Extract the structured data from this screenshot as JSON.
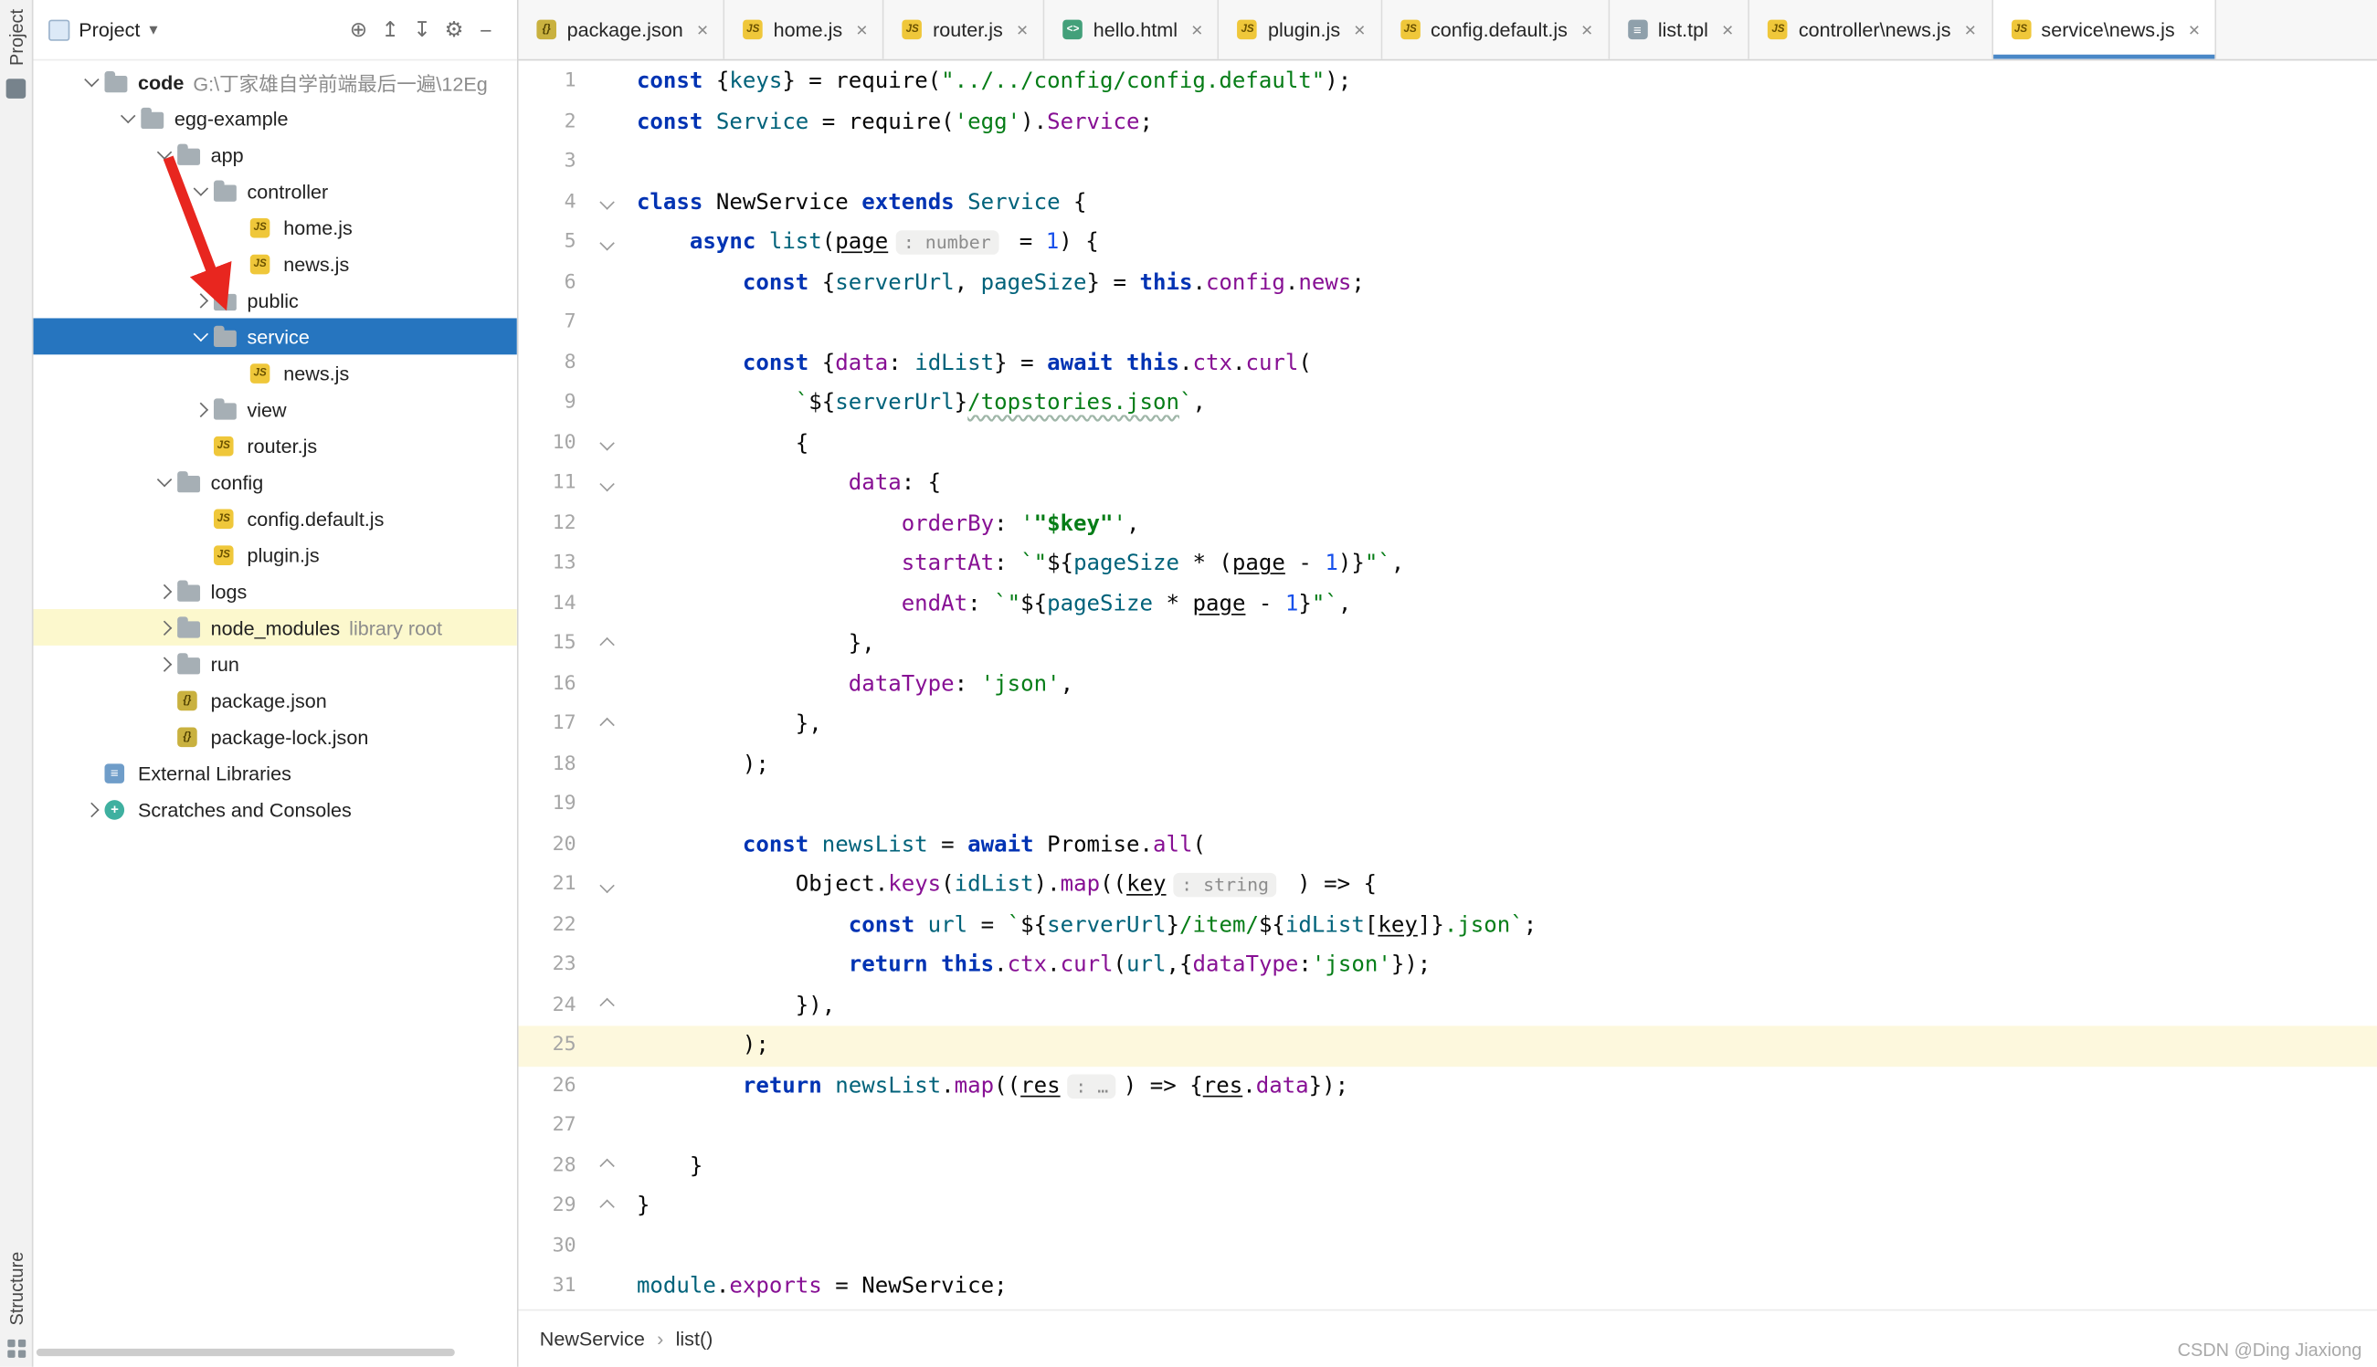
{
  "colors": {
    "selection_blue": "#2675bf",
    "library_row_yellow": "#fcf8cd",
    "current_line_yellow": "#fdf8dd",
    "arrow_red": "#e8261f",
    "keyword_blue": "#0033b3",
    "string_green": "#067d17",
    "number_blue": "#1750eb",
    "property_purple": "#871094",
    "identifier_teal": "#00627a"
  },
  "glyphs": {
    "caret_down": "▾",
    "close": "×",
    "crumb_sep": "›"
  },
  "left_strip": {
    "top_label": "Project",
    "bottom_label": "Structure"
  },
  "project_panel": {
    "title": "Project",
    "toolbar": [
      {
        "name": "locate",
        "glyph": "⊕"
      },
      {
        "name": "collapse-all",
        "glyph": "↥"
      },
      {
        "name": "expand-all",
        "glyph": "↧"
      },
      {
        "name": "settings-gear",
        "glyph": "⚙"
      },
      {
        "name": "hide-panel",
        "glyph": "−"
      }
    ],
    "tree": [
      {
        "label": "code",
        "suffix": "G:\\丁家雄自学前端最后一遍\\12Eg",
        "type": "folder",
        "level": 0,
        "chev": "down",
        "bold": true
      },
      {
        "label": "egg-example",
        "type": "folder",
        "level": 1,
        "chev": "down"
      },
      {
        "label": "app",
        "type": "folder",
        "level": 2,
        "chev": "down"
      },
      {
        "label": "controller",
        "type": "folder",
        "level": 3,
        "chev": "down"
      },
      {
        "label": "home.js",
        "type": "js",
        "level": 4,
        "chev": ""
      },
      {
        "label": "news.js",
        "type": "js",
        "level": 4,
        "chev": ""
      },
      {
        "label": "public",
        "type": "folder",
        "level": 3,
        "chev": "right"
      },
      {
        "label": "service",
        "type": "folder",
        "level": 3,
        "chev": "down",
        "selected": true
      },
      {
        "label": "news.js",
        "type": "js",
        "level": 4,
        "chev": ""
      },
      {
        "label": "view",
        "type": "folder",
        "level": 3,
        "chev": "right"
      },
      {
        "label": "router.js",
        "type": "js",
        "level": 3,
        "chev": ""
      },
      {
        "label": "config",
        "type": "folder",
        "level": 2,
        "chev": "down"
      },
      {
        "label": "config.default.js",
        "type": "js",
        "level": 3,
        "chev": ""
      },
      {
        "label": "plugin.js",
        "type": "js",
        "level": 3,
        "chev": ""
      },
      {
        "label": "logs",
        "type": "folder",
        "level": 2,
        "chev": "right"
      },
      {
        "label": "node_modules",
        "suffix": "library root",
        "type": "folder",
        "level": 2,
        "chev": "right",
        "highlight": true
      },
      {
        "label": "run",
        "type": "folder",
        "level": 2,
        "chev": "right"
      },
      {
        "label": "package.json",
        "type": "json",
        "level": 2,
        "chev": ""
      },
      {
        "label": "package-lock.json",
        "type": "json",
        "level": 2,
        "chev": ""
      },
      {
        "label": "External Libraries",
        "type": "libs",
        "level": 0,
        "chev": ""
      },
      {
        "label": "Scratches and Consoles",
        "type": "scratch",
        "level": 0,
        "chev": "right"
      }
    ]
  },
  "tabs": [
    {
      "label": "package.json",
      "icon": "json"
    },
    {
      "label": "home.js",
      "icon": "js"
    },
    {
      "label": "router.js",
      "icon": "js"
    },
    {
      "label": "hello.html",
      "icon": "html"
    },
    {
      "label": "plugin.js",
      "icon": "js"
    },
    {
      "label": "config.default.js",
      "icon": "js"
    },
    {
      "label": "list.tpl",
      "icon": "tpl"
    },
    {
      "label": "controller\\news.js",
      "icon": "js"
    },
    {
      "label": "service\\news.js",
      "icon": "js",
      "active": true
    }
  ],
  "editor": {
    "breadcrumbs": [
      "NewService",
      "list()"
    ],
    "lines": [
      {
        "n": 1,
        "segs": [
          [
            "k",
            "const"
          ],
          [
            "d",
            " {"
          ],
          [
            "v",
            "keys"
          ],
          [
            "d",
            "} = "
          ],
          [
            "d",
            "require("
          ],
          [
            "s",
            "\"../../config/config.default\""
          ],
          [
            "d",
            ");"
          ]
        ]
      },
      {
        "n": 2,
        "segs": [
          [
            "k",
            "const"
          ],
          [
            "d",
            " "
          ],
          [
            "v",
            "Service"
          ],
          [
            "d",
            " = "
          ],
          [
            "d",
            "require("
          ],
          [
            "s",
            "'egg'"
          ],
          [
            "d",
            ")."
          ],
          [
            "p",
            "Service"
          ],
          [
            "d",
            ";"
          ]
        ]
      },
      {
        "n": 3,
        "segs": []
      },
      {
        "n": 4,
        "fold": "o",
        "segs": [
          [
            "k",
            "class"
          ],
          [
            "d",
            " "
          ],
          [
            "cl",
            "NewService"
          ],
          [
            "d",
            " "
          ],
          [
            "k",
            "extends"
          ],
          [
            "d",
            " "
          ],
          [
            "v",
            "Service"
          ],
          [
            "d",
            " {"
          ]
        ]
      },
      {
        "n": 5,
        "fold": "o",
        "segs": [
          [
            "d",
            "    "
          ],
          [
            "k",
            "async"
          ],
          [
            "d",
            " "
          ],
          [
            "fn",
            "list"
          ],
          [
            "d",
            "("
          ],
          [
            "pm",
            "page"
          ],
          [
            "h",
            ": number"
          ],
          [
            "d",
            " = "
          ],
          [
            "n",
            "1"
          ],
          [
            "d",
            ") {"
          ]
        ]
      },
      {
        "n": 6,
        "segs": [
          [
            "d",
            "        "
          ],
          [
            "k",
            "const"
          ],
          [
            "d",
            " {"
          ],
          [
            "v",
            "serverUrl"
          ],
          [
            "d",
            ", "
          ],
          [
            "v",
            "pageSize"
          ],
          [
            "d",
            "} = "
          ],
          [
            "k",
            "this"
          ],
          [
            "d",
            "."
          ],
          [
            "p",
            "config"
          ],
          [
            "d",
            "."
          ],
          [
            "p",
            "news"
          ],
          [
            "d",
            ";"
          ]
        ]
      },
      {
        "n": 7,
        "segs": []
      },
      {
        "n": 8,
        "segs": [
          [
            "d",
            "        "
          ],
          [
            "k",
            "const"
          ],
          [
            "d",
            " {"
          ],
          [
            "p",
            "data"
          ],
          [
            "d",
            ": "
          ],
          [
            "v",
            "idList"
          ],
          [
            "d",
            "} = "
          ],
          [
            "k",
            "await"
          ],
          [
            "d",
            " "
          ],
          [
            "k",
            "this"
          ],
          [
            "d",
            "."
          ],
          [
            "p",
            "ctx"
          ],
          [
            "d",
            "."
          ],
          [
            "p",
            "curl"
          ],
          [
            "d",
            "("
          ]
        ]
      },
      {
        "n": 9,
        "segs": [
          [
            "d",
            "            "
          ],
          [
            "s",
            "`"
          ],
          [
            "d",
            "${"
          ],
          [
            "v",
            "serverUrl"
          ],
          [
            "d",
            "}"
          ],
          [
            "sw",
            "/topstories.json"
          ],
          [
            "s",
            "`"
          ],
          [
            "d",
            ","
          ]
        ]
      },
      {
        "n": 10,
        "fold": "o",
        "segs": [
          [
            "d",
            "            {"
          ]
        ]
      },
      {
        "n": 11,
        "fold": "o",
        "segs": [
          [
            "d",
            "                "
          ],
          [
            "p",
            "data"
          ],
          [
            "d",
            ": {"
          ]
        ]
      },
      {
        "n": 12,
        "segs": [
          [
            "d",
            "                    "
          ],
          [
            "p",
            "orderBy"
          ],
          [
            "d",
            ": "
          ],
          [
            "s",
            "'"
          ],
          [
            "sb",
            "\"$key\""
          ],
          [
            "s",
            "'"
          ],
          [
            "d",
            ","
          ]
        ]
      },
      {
        "n": 13,
        "segs": [
          [
            "d",
            "                    "
          ],
          [
            "p",
            "startAt"
          ],
          [
            "d",
            ": "
          ],
          [
            "s",
            "`\""
          ],
          [
            "d",
            "${"
          ],
          [
            "v",
            "pageSize"
          ],
          [
            "d",
            " * ("
          ],
          [
            "pm",
            "page"
          ],
          [
            "d",
            " - "
          ],
          [
            "n",
            "1"
          ],
          [
            "d",
            ")}"
          ],
          [
            "s",
            "\"`"
          ],
          [
            "d",
            ","
          ]
        ]
      },
      {
        "n": 14,
        "segs": [
          [
            "d",
            "                    "
          ],
          [
            "p",
            "endAt"
          ],
          [
            "d",
            ": "
          ],
          [
            "s",
            "`\""
          ],
          [
            "d",
            "${"
          ],
          [
            "v",
            "pageSize"
          ],
          [
            "d",
            " * "
          ],
          [
            "pm",
            "page"
          ],
          [
            "d",
            " - "
          ],
          [
            "n",
            "1"
          ],
          [
            "d",
            "}"
          ],
          [
            "s",
            "\"`"
          ],
          [
            "d",
            ","
          ]
        ]
      },
      {
        "n": 15,
        "fold": "e",
        "segs": [
          [
            "d",
            "                },"
          ]
        ]
      },
      {
        "n": 16,
        "segs": [
          [
            "d",
            "                "
          ],
          [
            "p",
            "dataType"
          ],
          [
            "d",
            ": "
          ],
          [
            "s",
            "'json'"
          ],
          [
            "d",
            ","
          ]
        ]
      },
      {
        "n": 17,
        "fold": "e",
        "segs": [
          [
            "d",
            "            },"
          ]
        ]
      },
      {
        "n": 18,
        "segs": [
          [
            "d",
            "        );"
          ]
        ]
      },
      {
        "n": 19,
        "segs": []
      },
      {
        "n": 20,
        "segs": [
          [
            "d",
            "        "
          ],
          [
            "k",
            "const"
          ],
          [
            "d",
            " "
          ],
          [
            "v",
            "newsList"
          ],
          [
            "d",
            " = "
          ],
          [
            "k",
            "await"
          ],
          [
            "d",
            " "
          ],
          [
            "d",
            "Promise"
          ],
          [
            "d",
            "."
          ],
          [
            "p",
            "all"
          ],
          [
            "d",
            "("
          ]
        ]
      },
      {
        "n": 21,
        "fold": "o",
        "segs": [
          [
            "d",
            "            "
          ],
          [
            "d",
            "Object"
          ],
          [
            "d",
            "."
          ],
          [
            "p",
            "keys"
          ],
          [
            "d",
            "("
          ],
          [
            "v",
            "idList"
          ],
          [
            "d",
            ")."
          ],
          [
            "p",
            "map"
          ],
          [
            "d",
            "(("
          ],
          [
            "pm",
            "key"
          ],
          [
            "h",
            ": string"
          ],
          [
            "d",
            " ) => {"
          ]
        ]
      },
      {
        "n": 22,
        "segs": [
          [
            "d",
            "                "
          ],
          [
            "k",
            "const"
          ],
          [
            "d",
            " "
          ],
          [
            "v",
            "url"
          ],
          [
            "d",
            " = "
          ],
          [
            "s",
            "`"
          ],
          [
            "d",
            "${"
          ],
          [
            "v",
            "serverUrl"
          ],
          [
            "d",
            "}"
          ],
          [
            "s",
            "/item/"
          ],
          [
            "d",
            "${"
          ],
          [
            "v",
            "idList"
          ],
          [
            "d",
            "["
          ],
          [
            "pm",
            "key"
          ],
          [
            "d",
            "]}"
          ],
          [
            "s",
            ".json`"
          ],
          [
            "d",
            ";"
          ]
        ]
      },
      {
        "n": 23,
        "segs": [
          [
            "d",
            "                "
          ],
          [
            "k",
            "return"
          ],
          [
            "d",
            " "
          ],
          [
            "k",
            "this"
          ],
          [
            "d",
            "."
          ],
          [
            "p",
            "ctx"
          ],
          [
            "d",
            "."
          ],
          [
            "p",
            "curl"
          ],
          [
            "d",
            "("
          ],
          [
            "v",
            "url"
          ],
          [
            "d",
            ",{"
          ],
          [
            "p",
            "dataType"
          ],
          [
            "d",
            ":"
          ],
          [
            "s",
            "'json'"
          ],
          [
            "d",
            "});"
          ]
        ]
      },
      {
        "n": 24,
        "fold": "e",
        "segs": [
          [
            "d",
            "            }),"
          ]
        ]
      },
      {
        "n": 25,
        "cur": true,
        "segs": [
          [
            "d",
            "        );"
          ]
        ]
      },
      {
        "n": 26,
        "segs": [
          [
            "d",
            "        "
          ],
          [
            "k",
            "return"
          ],
          [
            "d",
            " "
          ],
          [
            "v",
            "newsList"
          ],
          [
            "d",
            "."
          ],
          [
            "p",
            "map"
          ],
          [
            "d",
            "(("
          ],
          [
            "pm",
            "res"
          ],
          [
            "h",
            ": …"
          ],
          [
            "d",
            ") => {"
          ],
          [
            "pm",
            "res"
          ],
          [
            "d",
            "."
          ],
          [
            "p",
            "data"
          ],
          [
            "d",
            "});"
          ]
        ]
      },
      {
        "n": 27,
        "segs": []
      },
      {
        "n": 28,
        "fold": "e",
        "segs": [
          [
            "d",
            "    }"
          ]
        ]
      },
      {
        "n": 29,
        "fold": "e",
        "segs": [
          [
            "d",
            "}"
          ]
        ]
      },
      {
        "n": 30,
        "segs": []
      },
      {
        "n": 31,
        "segs": [
          [
            "v",
            "module"
          ],
          [
            "d",
            "."
          ],
          [
            "p",
            "exports"
          ],
          [
            "d",
            " = "
          ],
          [
            "d",
            "NewService"
          ],
          [
            "d",
            ";"
          ]
        ]
      }
    ]
  },
  "watermark": "CSDN @Ding Jiaxiong"
}
